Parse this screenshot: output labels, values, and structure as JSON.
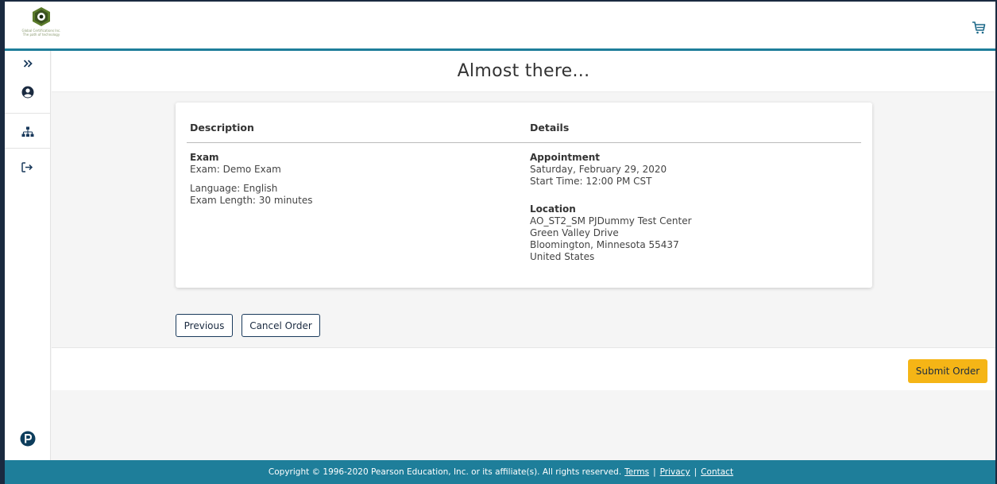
{
  "header": {
    "logo_text_line1": "Global Certifications Inc.",
    "logo_text_line2": "The path of technology",
    "cart_icon": "shopping-cart-icon"
  },
  "sidebar": {
    "items": [
      {
        "icon": "double-chevron-right-icon"
      },
      {
        "icon": "user-circle-icon"
      },
      {
        "icon": "sitemap-icon"
      },
      {
        "icon": "sign-out-icon"
      }
    ],
    "bottom_icon": "pearson-logo-icon"
  },
  "page": {
    "title": "Almost there..."
  },
  "summary": {
    "description_header": "Description",
    "details_header": "Details",
    "exam": {
      "heading": "Exam",
      "name": "Exam: Demo Exam",
      "language": "Language: English",
      "length": "Exam Length: 30 minutes"
    },
    "appointment": {
      "heading": "Appointment",
      "date": "Saturday, February 29, 2020",
      "start_time": "Start Time: 12:00 PM CST"
    },
    "location": {
      "heading": "Location",
      "name": "AO_ST2_SM PJDummy Test Center",
      "street": "Green Valley Drive",
      "city": "Bloomington, Minnesota 55437",
      "country": "United States"
    }
  },
  "actions": {
    "previous_label": "Previous",
    "cancel_label": "Cancel Order",
    "submit_label": "Submit Order"
  },
  "footer": {
    "copyright": "Copyright © 1996-2020 Pearson Education, Inc. or its affiliate(s). All rights reserved.",
    "terms": "Terms",
    "privacy": "Privacy",
    "contact": "Contact",
    "separator": "|"
  },
  "colors": {
    "accent_teal": "#1e7e9a",
    "navy": "#1a2a40",
    "submit_yellow": "#f5b516"
  }
}
